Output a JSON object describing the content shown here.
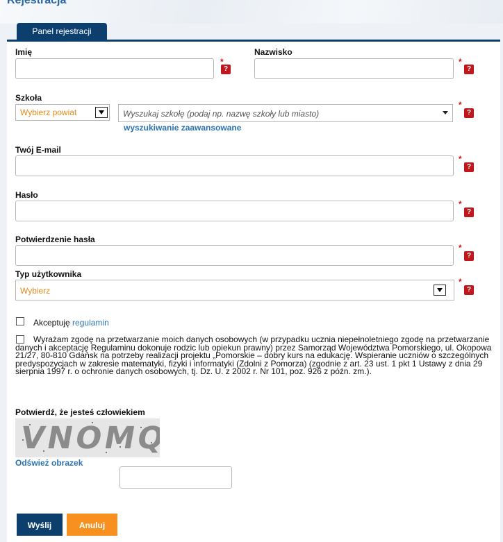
{
  "page": {
    "title": "Rejestracja"
  },
  "panel": {
    "tab_label": "Panel rejestracji"
  },
  "form": {
    "first_name": {
      "label": "Imię",
      "value": ""
    },
    "last_name": {
      "label": "Nazwisko",
      "value": ""
    },
    "school": {
      "label": "Szkoła",
      "district_select": "Wybierz powiat",
      "search_placeholder": "Wyszukaj szkołę (podaj np. nazwę szkoły lub miasto)",
      "advanced_link": "wyszukiwanie zaawansowane"
    },
    "email": {
      "label": "Twój E-mail",
      "value": ""
    },
    "password": {
      "label": "Hasło",
      "value": ""
    },
    "password_confirm": {
      "label": "Potwierdzenie hasła",
      "value": ""
    },
    "user_type": {
      "label": "Typ użytkownika",
      "selected": "Wybierz"
    },
    "required_mark": "*",
    "help_mark": "?",
    "terms": {
      "text": "Akceptuję",
      "link": "regulamin",
      "checked": false
    },
    "consent": {
      "checked": false,
      "text": "Wyrażam zgodę na przetwarzanie moich danych osobowych (w przypadku ucznia niepełnoletniego zgodę na przetwarzanie danych i akceptację Regulaminu dokonuje rodzic lub opiekun prawny) przez Samorząd Województwa Pomorskiego, ul. Okopowa 21/27, 80-810 Gdańsk na potrzeby realizacji projektu „Pomorskie – dobry kurs na edukację. Wspieranie uczniów o szczególnych predyspozycjach w zakresie matematyki, fizyki i informatyki (Zdolni z Pomorza) (zgodnie z art. 23 ust. 1 pkt 1 Ustawy z dnia 29 sierpnia 1997 r. o ochronie danych osobowych, tj. Dz. U. z 2002 r. Nr 101, poz. 926 z późn. zm.)."
    },
    "captcha": {
      "label": "Potwierdź, że jesteś człowiekiem",
      "image_text": "VNOMQ",
      "refresh_link": "Odśwież obrazek",
      "value": ""
    }
  },
  "buttons": {
    "send": "Wyślij",
    "cancel": "Anuluj"
  },
  "colors": {
    "primary": "#0c3f6d",
    "accent": "#f7901e",
    "link": "#2a73b3",
    "required": "#d01414",
    "help": "#c0171d",
    "select_text": "#e38a1b"
  }
}
